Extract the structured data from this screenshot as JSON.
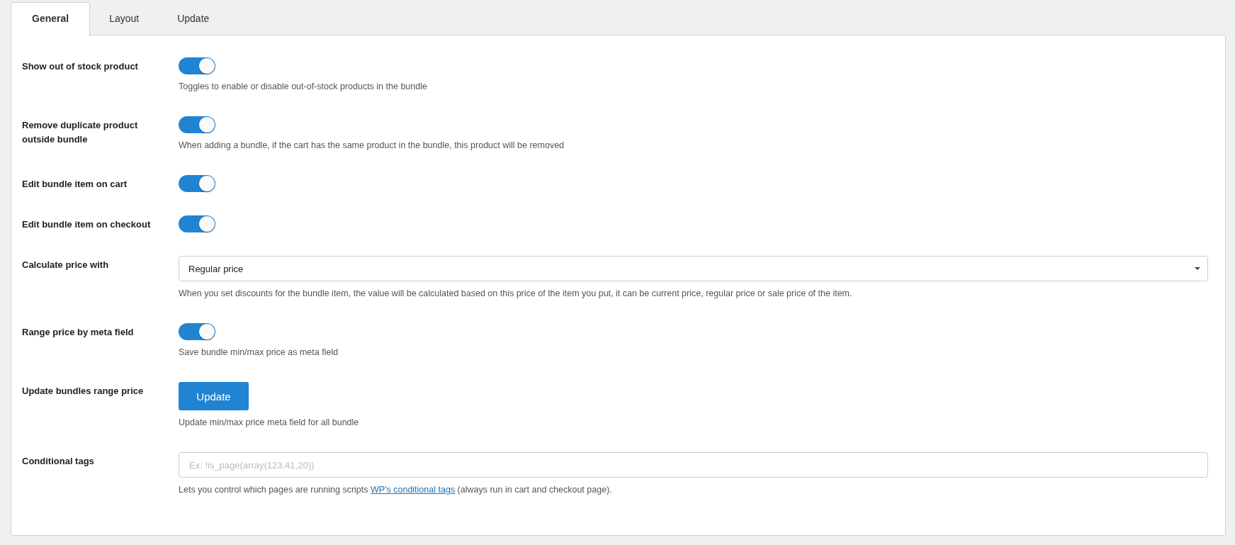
{
  "tabs": [
    {
      "label": "General",
      "selected": true
    },
    {
      "label": "Layout",
      "selected": false
    },
    {
      "label": "Update",
      "selected": false
    }
  ],
  "settings": [
    {
      "kind": "toggle",
      "label": "Show out of stock product",
      "on": true,
      "help": "Toggles to enable or disable out-of-stock products in the bundle"
    },
    {
      "kind": "toggle",
      "label": "Remove duplicate product outside bundle",
      "on": true,
      "help": "When adding a bundle, if the cart has the same product in the bundle, this product will be removed"
    },
    {
      "kind": "toggle",
      "label": "Edit bundle item on cart",
      "on": true
    },
    {
      "kind": "toggle",
      "label": "Edit bundle item on checkout",
      "on": true
    },
    {
      "kind": "select",
      "label": "Calculate price with",
      "value": "Regular price",
      "help": "When you set discounts for the bundle item, the value will be calculated based on this price of the item you put, it can be current price, regular price or sale price of the item."
    },
    {
      "kind": "toggle",
      "label": "Range price by meta field",
      "on": true,
      "help": "Save bundle min/max price as meta field"
    },
    {
      "kind": "button",
      "label": "Update bundles range price",
      "button": "Update",
      "help": "Update min/max price meta field for all bundle"
    },
    {
      "kind": "text",
      "label": "Conditional tags",
      "placeholder": "Ex: !is_page(array(123,41,20))",
      "help": "Lets you control which pages are running scripts ",
      "link": "WP's conditional tags",
      "help_after": " (always run in cart and checkout page)."
    }
  ]
}
